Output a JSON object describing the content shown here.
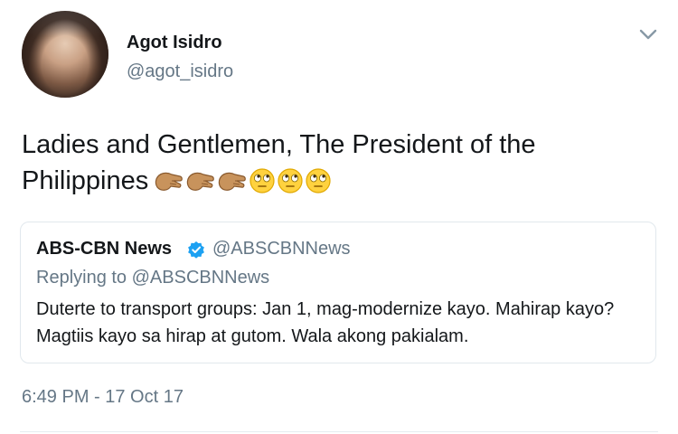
{
  "tweet": {
    "author_name": "Agot Isidro",
    "author_handle": "@agot_isidro",
    "text": "Ladies and Gentlemen, The President of the Philippines",
    "emojis": [
      "raised-back-of-hand-emoji",
      "raised-back-of-hand-emoji",
      "raised-back-of-hand-emoji",
      "face-with-rolling-eyes-emoji",
      "face-with-rolling-eyes-emoji",
      "face-with-rolling-eyes-emoji"
    ],
    "timestamp": "6:49 PM - 17 Oct 17"
  },
  "quoted_tweet": {
    "author_name": "ABS-CBN News",
    "author_handle": "@ABSCBNNews",
    "verified": true,
    "replying_to": "Replying to @ABSCBNNews",
    "text": "Duterte to transport groups: Jan 1, mag-modernize kayo. Mahirap kayo? Magtiis kayo sa hirap at gutom. Wala akong pakialam."
  },
  "icons": {
    "menu": "chevron-down-icon",
    "verified": "verified-badge-icon"
  },
  "colors": {
    "primary_text": "#14171a",
    "secondary_text": "#657786",
    "verified_blue": "#1da1f2",
    "border": "#e1e8ed"
  }
}
